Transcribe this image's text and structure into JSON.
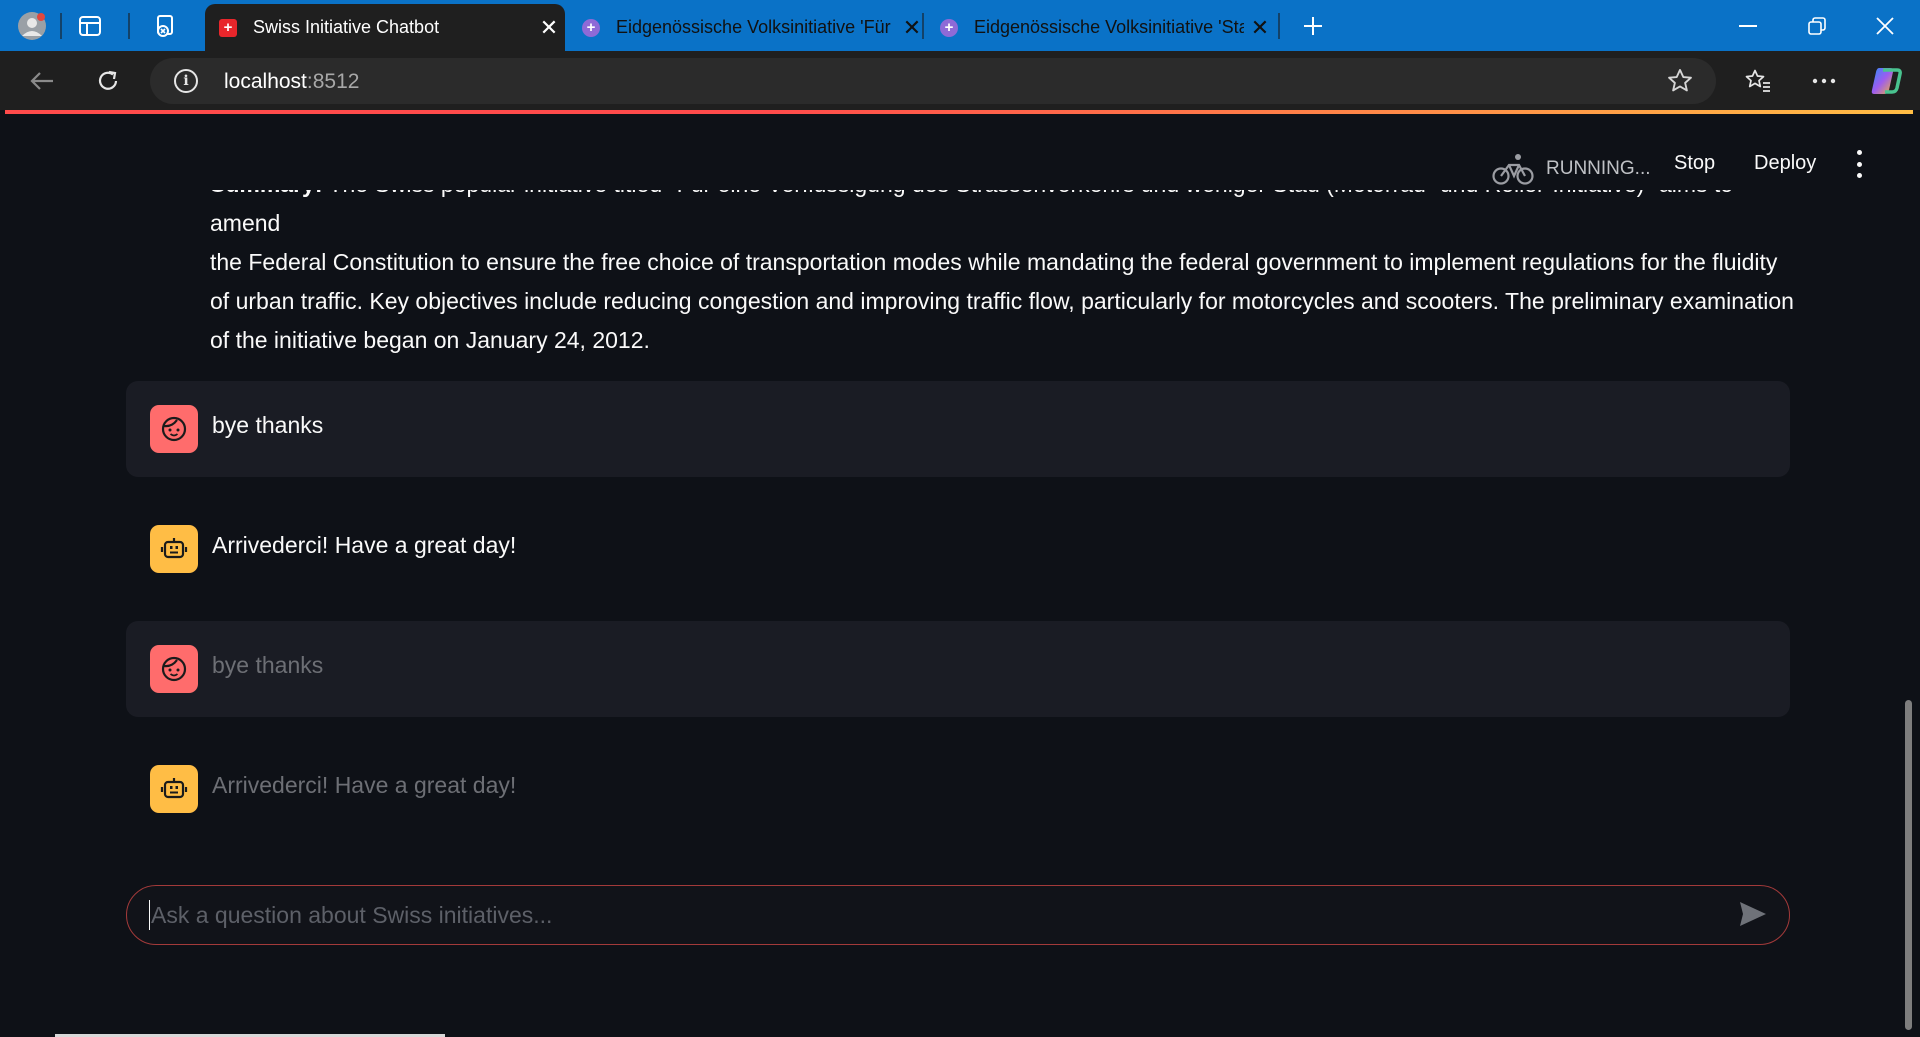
{
  "browser": {
    "tabs": [
      {
        "title": "Swiss Initiative Chatbot",
        "active": true
      },
      {
        "title": "Eidgenössische Volksinitiative 'Für",
        "active": false
      },
      {
        "title": "Eidgenössische Volksinitiative 'Sta",
        "active": false
      }
    ],
    "address": {
      "host": "localhost",
      "port": ":8512"
    }
  },
  "header": {
    "status": "RUNNING...",
    "stop_label": "Stop",
    "deploy_label": "Deploy"
  },
  "summary": {
    "label": "Summary:",
    "text_cut": " The Swiss popular initiative titled \"Für eine Verflüssigung des Strassenverkehrs und weniger Stau (Motorrad- und Roller-Initiative)\" aims to amend",
    "line2": "the Federal Constitution to ensure the free choice of transportation modes while mandating the federal government to implement regulations for the fluidity",
    "line3": "of urban traffic. Key objectives include reducing congestion and improving traffic flow, particularly for motorcycles and scooters. The preliminary examination",
    "line4": "of the initiative began on January 24, 2012."
  },
  "messages": [
    {
      "role": "user",
      "text": "bye thanks"
    },
    {
      "role": "assistant",
      "text": "Arrivederci! Have a great day!"
    },
    {
      "role": "user",
      "text": "bye thanks"
    },
    {
      "role": "assistant",
      "text": "Arrivederci! Have a great day!"
    }
  ],
  "chat_input": {
    "placeholder": "Ask a question about Swiss initiatives..."
  },
  "colors": {
    "accent": "#ff4b4b",
    "user_avatar": "#ff6c6c",
    "bot_avatar": "#ffbd45",
    "background": "#0e1117",
    "tabbar": "#0a72c7"
  },
  "icons": [
    "profile-icon",
    "workspaces-icon",
    "vertical-tabs-icon",
    "swiss-flag-icon",
    "admin-ch-icon",
    "new-tab-icon",
    "minimize-icon",
    "restore-icon",
    "close-icon",
    "back-icon",
    "refresh-icon",
    "site-info-icon",
    "favorite-star-icon",
    "favorites-icon",
    "more-icon",
    "copilot-icon",
    "bike-running-icon",
    "kebab-menu-icon",
    "user-face-icon",
    "robot-icon",
    "send-icon"
  ]
}
